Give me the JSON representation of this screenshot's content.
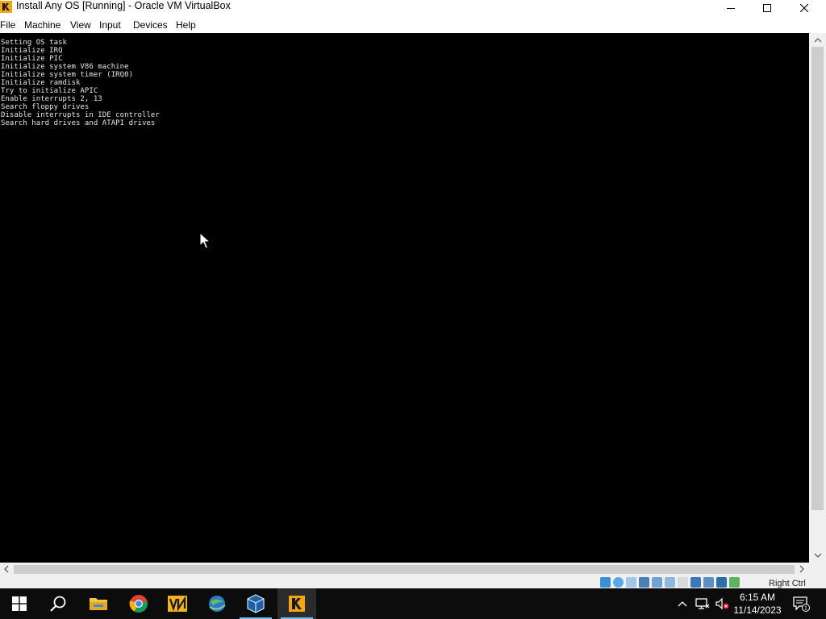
{
  "window": {
    "title": "Install Any OS [Running] - Oracle VM VirtualBox"
  },
  "menu": {
    "items": [
      "File",
      "Machine",
      "View",
      "Input",
      "Devices",
      "Help"
    ]
  },
  "console": {
    "lines": [
      "Setting OS task",
      "Initialize IRQ",
      "Initialize PIC",
      "Initialize system V86 machine",
      "Initialize system timer (IRQ0)",
      "Initialize ramdisk",
      "Try to initialize APIC",
      "Enable interrupts 2, 13",
      "Search floppy drives",
      "Disable interrupts in IDE controller",
      "Search hard drives and ATAPI drives"
    ]
  },
  "statusbar": {
    "host_key": "Right Ctrl",
    "icons": [
      "hard-disk-icon",
      "optical-drive-icon",
      "audio-icon",
      "network-icon",
      "usb-icon",
      "shared-folders-icon",
      "display-icon",
      "recording-icon",
      "capture-icon",
      "mouse-integration-icon",
      "host-key-icon"
    ]
  },
  "taskbar": {
    "apps": [
      "start-button",
      "search-button",
      "file-explorer",
      "google-chrome",
      "vpn-app",
      "internet-download-app",
      "virtualbox-manager",
      "virtualbox-vm"
    ],
    "time": "6:15 AM",
    "date": "11/14/2023",
    "notification_count": "1"
  },
  "colors": {
    "vm_background": "#000000",
    "console_text": "#e6e6e6",
    "taskbar_background": "#0c0c0c",
    "active_underline": "#76b9ed"
  }
}
